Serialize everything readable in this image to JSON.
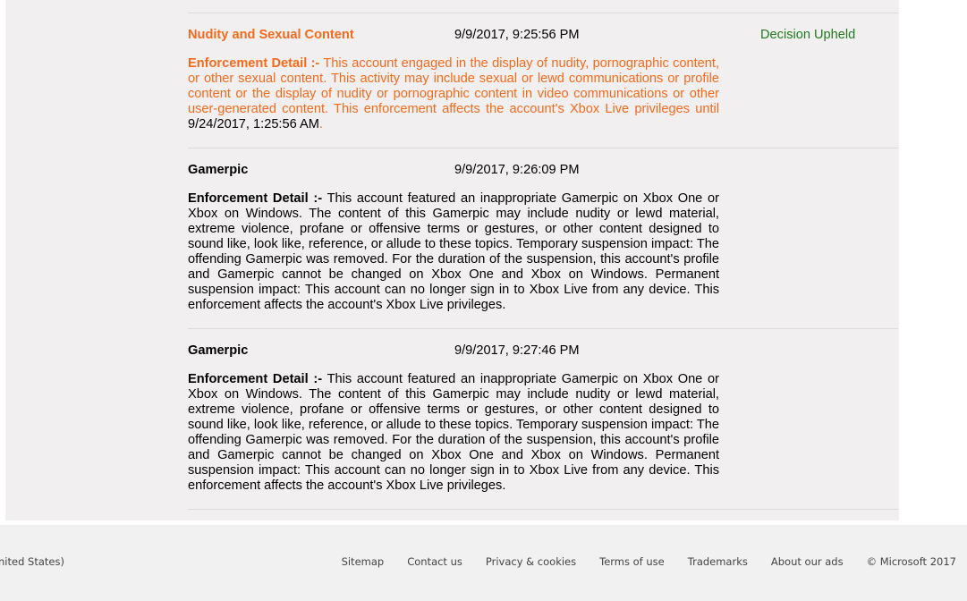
{
  "enforcements": [
    {
      "category": "Nudity and Sexual Content",
      "timestamp": "9/9/2017, 9:25:56 PM",
      "status": "Decision Upheld",
      "detail_label": "Enforcement Detail :-",
      "detail_text": " This account engaged in the display of nudity, pornographic content, or other sexual content. This activity may include sexual or lewd communications or profile content or the display of nudity or pornographic content in video communications or other user-generated content. This enforcement affects the account's Xbox Live privileges until ",
      "until_date": "9/24/2017, 1:25:56 AM",
      "detail_suffix": "."
    },
    {
      "category": "Gamerpic",
      "timestamp": "9/9/2017, 9:26:09 PM",
      "status": "",
      "detail_label": "Enforcement Detail :-",
      "detail_text": " This account featured an inappropriate Gamerpic on Xbox One or Xbox on Windows. The content of this Gamerpic may include nudity or lewd material, extreme violence, profane or offensive terms or gestures, or other content designed to sound like, look like, reference, or allude to these topics. Temporary suspension impact: The offending Gamerpic was removed. For the duration of the suspension, this account's profile and Gamerpic cannot be changed on Xbox One and Xbox on Windows. Permanent suspension impact: This account can no longer sign in to Xbox Live from any device. This enforcement affects the account's Xbox Live privileges."
    },
    {
      "category": "Gamerpic",
      "timestamp": "9/9/2017, 9:27:46 PM",
      "status": "",
      "detail_label": "Enforcement Detail :-",
      "detail_text": " This account featured an inappropriate Gamerpic on Xbox One or Xbox on Windows. The content of this Gamerpic may include nudity or lewd material, extreme violence, profane or offensive terms or gestures, or other content designed to sound like, look like, reference, or allude to these topics. Temporary suspension impact: The offending Gamerpic was removed. For the duration of the suspension, this account's profile and Gamerpic cannot be changed on Xbox One and Xbox on Windows. Permanent suspension impact: This account can no longer sign in to Xbox Live from any device. This enforcement affects the account's Xbox Live privileges."
    }
  ],
  "footer": {
    "locale": "nited States)",
    "links": [
      "Sitemap",
      "Contact us",
      "Privacy & cookies",
      "Terms of use",
      "Trademarks",
      "About our ads"
    ],
    "copyright": "© Microsoft 2017"
  },
  "colors": {
    "highlight": "#f26b1d",
    "status_upheld": "#1e7a1e"
  }
}
